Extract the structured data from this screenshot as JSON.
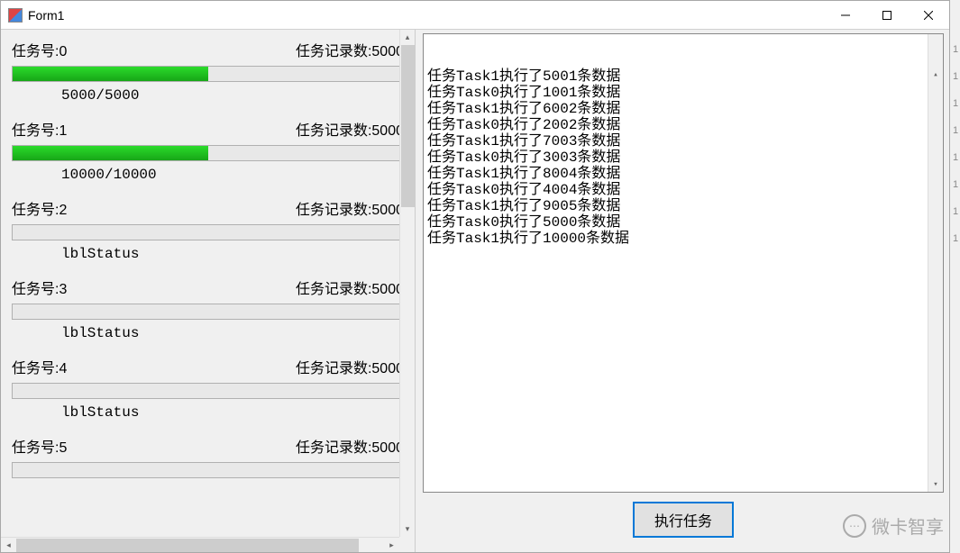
{
  "window": {
    "title": "Form1"
  },
  "tasks": [
    {
      "id_label": "任务号:0",
      "count_label": "任务记录数:5000",
      "status": "5000/5000",
      "progress_pct": 50
    },
    {
      "id_label": "任务号:1",
      "count_label": "任务记录数:5000",
      "status": "10000/10000",
      "progress_pct": 50
    },
    {
      "id_label": "任务号:2",
      "count_label": "任务记录数:5000",
      "status": "lblStatus",
      "progress_pct": 0
    },
    {
      "id_label": "任务号:3",
      "count_label": "任务记录数:5000",
      "status": "lblStatus",
      "progress_pct": 0
    },
    {
      "id_label": "任务号:4",
      "count_label": "任务记录数:5000",
      "status": "lblStatus",
      "progress_pct": 0
    },
    {
      "id_label": "任务号:5",
      "count_label": "任务记录数:5000",
      "status": "",
      "progress_pct": 0
    }
  ],
  "log_lines": [
    "任务Task1执行了5001条数据",
    "任务Task0执行了1001条数据",
    "任务Task1执行了6002条数据",
    "任务Task0执行了2002条数据",
    "任务Task1执行了7003条数据",
    "任务Task0执行了3003条数据",
    "任务Task1执行了8004条数据",
    "任务Task0执行了4004条数据",
    "任务Task1执行了9005条数据",
    "任务Task0执行了5000条数据",
    "任务Task1执行了10000条数据"
  ],
  "buttons": {
    "execute": "执行任务"
  },
  "watermark": {
    "text": "微卡智享"
  },
  "side_marks": [
    "1",
    "1",
    "1",
    "1",
    "1",
    "1",
    "1",
    "1"
  ]
}
